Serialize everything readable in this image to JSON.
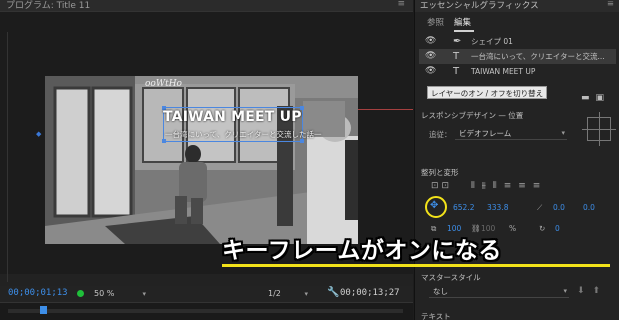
{
  "monitor": {
    "title": "プログラム: Title 11",
    "timecode_current": "00;00;01;13",
    "zoom": "50 %",
    "resolution": "1/2",
    "timecode_duration": "00;00;13;27"
  },
  "video": {
    "title_text": "TAIWAN MEET UP",
    "subtitle_text": "一台湾にいって、クリエイターと交流した話一"
  },
  "eg": {
    "panel_title": "エッセンシャルグラフィックス",
    "tabs": [
      "参照",
      "編集"
    ],
    "active_tab": "編集",
    "layers": [
      {
        "icon": "pen-icon",
        "name": "シェイプ 01"
      },
      {
        "icon": "text-icon",
        "name": "一台湾にいって、クリエイターと交流..."
      },
      {
        "icon": "text-icon",
        "name": "TAIWAN MEET UP"
      }
    ],
    "tooltip": "レイヤーのオン / オフを切り替え",
    "responsive_label": "レスポンシブデザイン — 位置",
    "follow_label": "追従：",
    "follow_value": "ビデオフレーム",
    "align_label": "整列と変形",
    "position_x": "652.2",
    "position_y": "333.8",
    "rotation_x": "0.0",
    "rotation_y": "0.0",
    "scale": "100",
    "scale_linked": "100",
    "scale_unit": "%",
    "rotation": "0",
    "master_style_label": "マスタースタイル",
    "master_style_value": "なし",
    "text_section_label": "テキスト"
  },
  "caption": {
    "text": "キーフレームがオンになる",
    "underline_color": "#f2e21a"
  },
  "colors": {
    "accent_blue": "#3d8ee8",
    "highlight_yellow": "#f2e21a",
    "panel_bg": "#232323"
  }
}
